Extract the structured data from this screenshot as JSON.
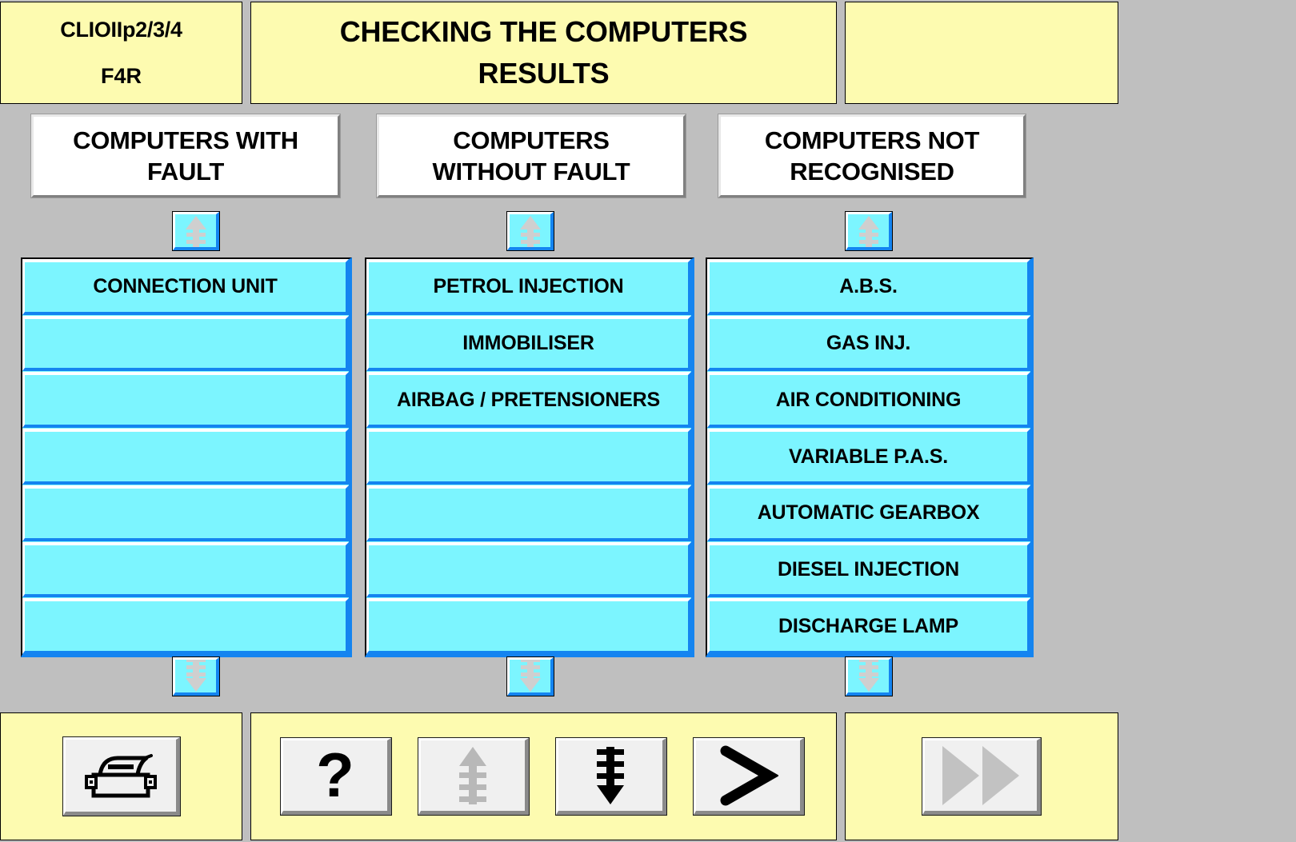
{
  "header": {
    "vehicle": "CLIOIIp2/3/4",
    "engine": "F4R",
    "title_line1": "CHECKING THE COMPUTERS",
    "title_line2": "RESULTS",
    "right_panel": ""
  },
  "colors": {
    "background": "#bfbfbf",
    "panel_yellow": "#fdfbb0",
    "list_cyan": "#7cf5ff",
    "bevel_blue": "#1484f0",
    "button_face": "#f0f0f0",
    "disabled_gray": "#c0c0c0"
  },
  "columns": [
    {
      "header_line1": "COMPUTERS WITH",
      "header_line2": "FAULT",
      "scroll_up_icon": "scroll-up-icon",
      "scroll_down_icon": "scroll-down-icon",
      "rows": [
        "CONNECTION UNIT",
        "",
        "",
        "",
        "",
        "",
        ""
      ]
    },
    {
      "header_line1": "COMPUTERS",
      "header_line2": "WITHOUT FAULT",
      "scroll_up_icon": "scroll-up-icon",
      "scroll_down_icon": "scroll-down-icon",
      "rows": [
        "PETROL INJECTION",
        "IMMOBILISER",
        "AIRBAG / PRETENSIONERS",
        "",
        "",
        "",
        ""
      ]
    },
    {
      "header_line1": "COMPUTERS NOT",
      "header_line2": "RECOGNISED",
      "scroll_up_icon": "scroll-up-icon",
      "scroll_down_icon": "scroll-down-icon",
      "rows": [
        "A.B.S.",
        "GAS INJ.",
        "AIR CONDITIONING",
        "VARIABLE P.A.S.",
        "AUTOMATIC GEARBOX",
        "DIESEL INJECTION",
        "DISCHARGE LAMP"
      ]
    }
  ],
  "toolbar": {
    "print": {
      "icon": "printer-icon",
      "label": ""
    },
    "help": {
      "icon": "question-mark-icon",
      "label": "?"
    },
    "page_up": {
      "icon": "fast-scroll-up-icon",
      "label": "",
      "state": "disabled"
    },
    "page_down": {
      "icon": "fast-scroll-down-icon",
      "label": "",
      "state": "enabled"
    },
    "next": {
      "icon": "chevron-right-icon",
      "label": ">",
      "state": "enabled"
    },
    "forward": {
      "icon": "fast-forward-icon",
      "label": "",
      "state": "disabled"
    }
  }
}
